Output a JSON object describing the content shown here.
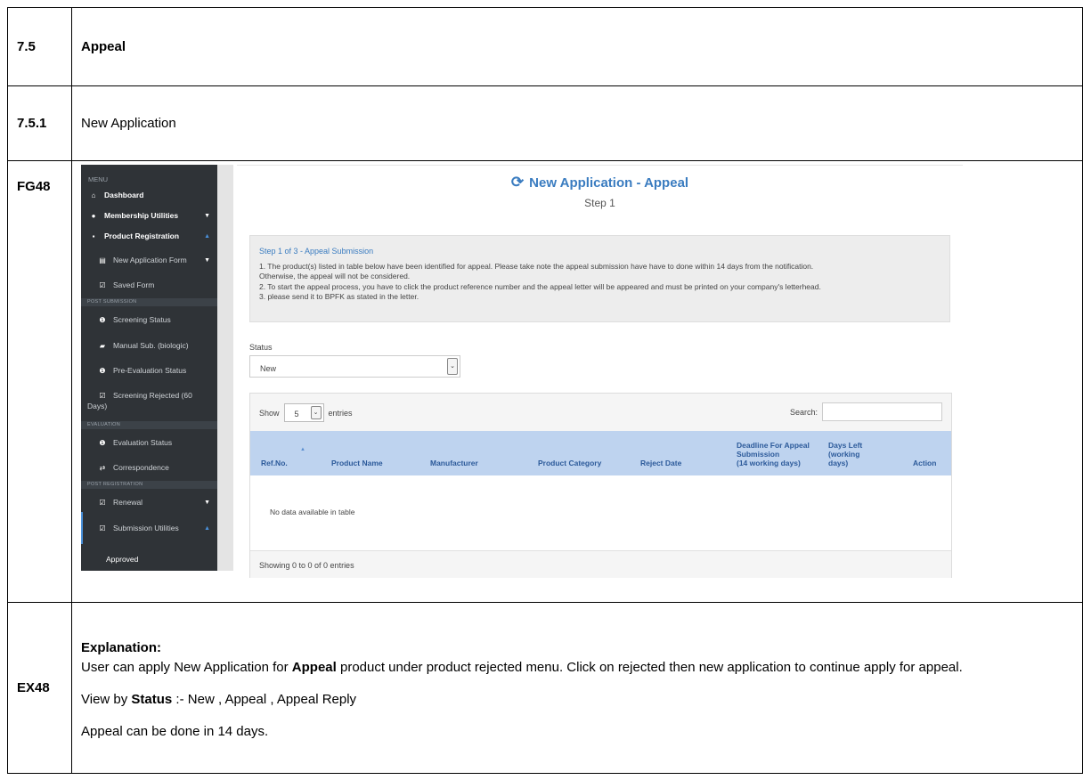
{
  "rows": {
    "section": {
      "key": "7.5",
      "title": "Appeal"
    },
    "subsection": {
      "key": "7.5.1",
      "title": "New Application"
    },
    "figure": {
      "key": "FG48"
    },
    "explanation": {
      "key": "EX48"
    }
  },
  "screenshot": {
    "sidebar": {
      "menu_label": "MENU",
      "items": [
        {
          "label": "Dashboard",
          "icon": "home-icon"
        },
        {
          "label": "Membership Utilities",
          "icon": "user-icon"
        },
        {
          "label": "Product Registration",
          "icon": "product-icon"
        },
        {
          "label": "New Application Form",
          "icon": "file-icon"
        },
        {
          "label": "Saved Form",
          "icon": "check-icon"
        },
        {
          "label": "Screening Status",
          "icon": "info-icon"
        },
        {
          "label": "Manual Sub. (biologic)",
          "icon": "book-icon"
        },
        {
          "label": "Pre-Evaluation Status",
          "icon": "info-icon"
        },
        {
          "label": "Screening Rejected (60",
          "label2": "Days)",
          "icon": "check-icon"
        },
        {
          "label": "Evaluation Status",
          "icon": "info-icon"
        },
        {
          "label": "Correspondence",
          "icon": "exchange-icon"
        },
        {
          "label": "Renewal",
          "icon": "check-icon"
        },
        {
          "label": "Submission Utilities",
          "icon": "check-icon"
        },
        {
          "label": "Approved",
          "icon": ""
        }
      ],
      "sections": [
        "POST SUBMISSION",
        "EVALUATION",
        "POST REGISTRATION"
      ]
    },
    "page_title": "New Application - Appeal",
    "step_label": "Step 1",
    "notice": {
      "heading": "Step 1 of 3 - Appeal Submission",
      "lines": [
        "1. The product(s) listed in table below have been identified for appeal. Please take note the appeal submission have have to done within 14 days from the notification.",
        "Otherwise, the appeal will not be considered.",
        "2. To start the appeal process, you have to click the product reference number and the appeal letter will be appeared and must be printed on your company's letterhead.",
        "3. please send it to BPFK as stated in the letter."
      ]
    },
    "status": {
      "label": "Status",
      "value": "New"
    },
    "table": {
      "show_label": "Show",
      "length_value": "5",
      "entries_label": "entries",
      "search_label": "Search:",
      "columns": {
        "ref": "Ref.No.",
        "product": "Product Name",
        "manufacturer": "Manufacturer",
        "category": "Product Category",
        "reject": "Reject Date",
        "deadline": [
          "Deadline For Appeal",
          "Submission",
          "(14 working days)"
        ],
        "days": [
          "Days Left",
          "(working",
          "days)"
        ],
        "action": "Action"
      },
      "empty_text": "No data available in table",
      "footer": "Showing 0 to 0 of 0 entries"
    }
  },
  "explanation": {
    "heading": "Explanation:",
    "p1_a": "User can apply New Application for ",
    "p1_b": "Appeal",
    "p1_c": " product under product rejected menu. Click on rejected then new application to continue apply for appeal.",
    "p2_a": "View by ",
    "p2_b": "Status",
    "p2_c": " :- New , Appeal , Appeal Reply",
    "p3": "Appeal can be done in 14 days."
  }
}
